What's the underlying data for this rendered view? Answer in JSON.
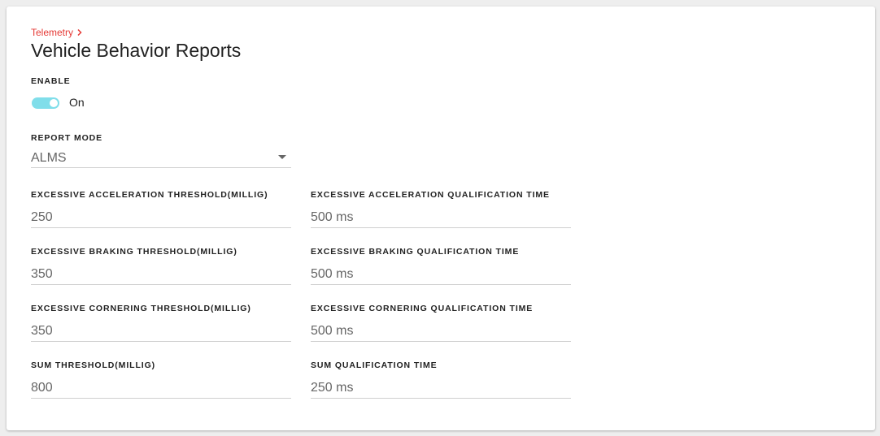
{
  "breadcrumb": {
    "label": "Telemetry"
  },
  "page": {
    "title": "Vehicle Behavior Reports"
  },
  "enable": {
    "label": "ENABLE",
    "state_text": "On",
    "checked": true
  },
  "report_mode": {
    "label": "REPORT MODE",
    "value": "ALMS"
  },
  "fields": {
    "accel_threshold": {
      "label": "EXCESSIVE ACCELERATION THRESHOLD(MILLIG)",
      "value": "250"
    },
    "accel_time": {
      "label": "EXCESSIVE ACCELERATION QUALIFICATION TIME",
      "value": "500 ms"
    },
    "braking_threshold": {
      "label": "EXCESSIVE BRAKING THRESHOLD(MILLIG)",
      "value": "350"
    },
    "braking_time": {
      "label": "EXCESSIVE BRAKING QUALIFICATION TIME",
      "value": "500 ms"
    },
    "cornering_threshold": {
      "label": "EXCESSIVE CORNERING THRESHOLD(MILLIG)",
      "value": "350"
    },
    "cornering_time": {
      "label": "EXCESSIVE CORNERING QUALIFICATION TIME",
      "value": "500 ms"
    },
    "sum_threshold": {
      "label": "SUM THRESHOLD(MILLIG)",
      "value": "800"
    },
    "sum_time": {
      "label": "SUM QUALIFICATION TIME",
      "value": "250 ms"
    }
  },
  "icons": {
    "breadcrumb_chevron": "chevron-right-icon",
    "select_caret": "caret-down-icon"
  },
  "colors": {
    "accent": "#e53935",
    "toggle_track": "#80deea",
    "toggle_knob": "#ffffff"
  }
}
